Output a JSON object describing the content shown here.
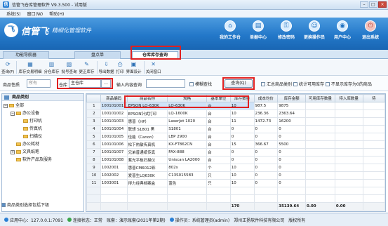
{
  "title": "信管飞仓库管理软件 V9.3.500 - 试用版",
  "window_controls": [
    "–",
    "□",
    "×"
  ],
  "menu": [
    "系统(S)",
    "窗口(W)",
    "帮助(H)"
  ],
  "brand": {
    "logo": "信管飞",
    "subtitle": "精细化管理软件",
    "mark": "飞"
  },
  "header_nav": [
    {
      "icon": "⌂",
      "label": "我的工作台"
    },
    {
      "icon": "▤",
      "label": "单据中心"
    },
    {
      "icon": "⚿",
      "label": "修改密码"
    },
    {
      "icon": "☺",
      "label": "更换操作员"
    },
    {
      "icon": "◉",
      "label": "用户中心"
    },
    {
      "icon": "⏻",
      "label": "退出系统"
    }
  ],
  "tabs": [
    "功能导航器",
    "盘点单",
    "仓库库存查询"
  ],
  "toolbar": [
    {
      "icon": "⟳",
      "label": "查询(F)"
    },
    {
      "icon": "▦",
      "label": "库存交易明细"
    },
    {
      "icon": "▥",
      "label": "分仓库存"
    },
    {
      "icon": "▧",
      "label": "批号查询"
    },
    {
      "icon": "✎",
      "label": "更正库存"
    },
    {
      "icon": "⇩",
      "label": "导出数据"
    },
    {
      "icon": "⎙",
      "label": "打印"
    },
    {
      "icon": "▣",
      "label": "界面设计"
    },
    {
      "icon": "✕",
      "label": "关闭窗口"
    }
  ],
  "filter": {
    "item_nature_label": "商品性质",
    "item_nature_value": "所有",
    "warehouse_label": "仓库",
    "warehouse_value": "主仓库",
    "ellipsis": "…",
    "query_label": "输入内容查询",
    "fuzzy": "模糊查找",
    "query_btn": "查询(Q)",
    "opt1": "汇总商品类别",
    "opt2": "统计可用库存",
    "opt3": "不显示库存为0的商品"
  },
  "sidebar": {
    "title": "商品类别",
    "nodes": [
      "全部",
      "办公设备",
      "打印机",
      "传真机",
      "扫描仪",
      "办公耗材",
      "文具纸笔",
      "软件产品及服务"
    ],
    "footer": "商品类别选择包括下级"
  },
  "table": {
    "headers": [
      "",
      "商品编码",
      "商品名称",
      "规格",
      "基本单位",
      "库存数量",
      "成本均价",
      "库存金额",
      "可用库存数量",
      "待入库数量",
      "待"
    ],
    "rows": [
      [
        "1",
        "100101001",
        "EPSON LQ-630K",
        "LQ-630K",
        "台",
        "10",
        "987.5",
        "9875",
        "",
        "",
        ""
      ],
      [
        "2",
        "100101002",
        "EPSON针式打印",
        "LQ-1600K",
        "台",
        "10",
        "236.36",
        "2363.64",
        "",
        "",
        ""
      ],
      [
        "3",
        "100101003",
        "惠普（HP）",
        "LaserJet 1020",
        "台",
        "11",
        "1472.73",
        "16200",
        "",
        "",
        ""
      ],
      [
        "4",
        "100101004",
        "联想 S1801 黑",
        "S1801",
        "台",
        "0",
        "0",
        "0",
        "",
        "",
        ""
      ],
      [
        "5",
        "100101005",
        "佳能（Canon）",
        "LBP 2900",
        "台",
        "0",
        "0",
        "0",
        "",
        "",
        ""
      ],
      [
        "6",
        "100101006",
        "松下热敏传真机",
        "KX-FT862CN",
        "台",
        "15",
        "366.67",
        "5500",
        "",
        "",
        ""
      ],
      [
        "7",
        "100101007",
        "兄弟普通纸传真",
        "FAX-888",
        "台",
        "0",
        "0",
        "0",
        "",
        "",
        ""
      ],
      [
        "8",
        "100101008",
        "紫光平板扫描仪",
        "Uniscan LA2000",
        "台",
        "0",
        "0",
        "0",
        "",
        "",
        ""
      ],
      [
        "9",
        "1002001",
        "惠普CM6012彩",
        "802s",
        "个",
        "10",
        "0",
        "0",
        "",
        "",
        ""
      ],
      [
        "10",
        "1002002",
        "爱普生LQ630K",
        "C13S015583",
        "只",
        "10",
        "0",
        "0",
        "",
        "",
        ""
      ],
      [
        "11",
        "1003001",
        "得力经典档案盒",
        "蓝色",
        "只",
        "10",
        "0",
        "0",
        "",
        "",
        ""
      ]
    ],
    "total_qty": "170",
    "total_amount": "35139.64",
    "total_avail": "0.00",
    "total_in": "0.00"
  },
  "status": {
    "server": "应用中心：127.0.0.1:7091",
    "conn": "连接状态：正常",
    "ledger": "账套：演示账套(2021年第2期)",
    "operator": "操作员：系统管理员(admin)",
    "company": "郑州正扬软件科技有限公司",
    "rights": "版权所有"
  }
}
